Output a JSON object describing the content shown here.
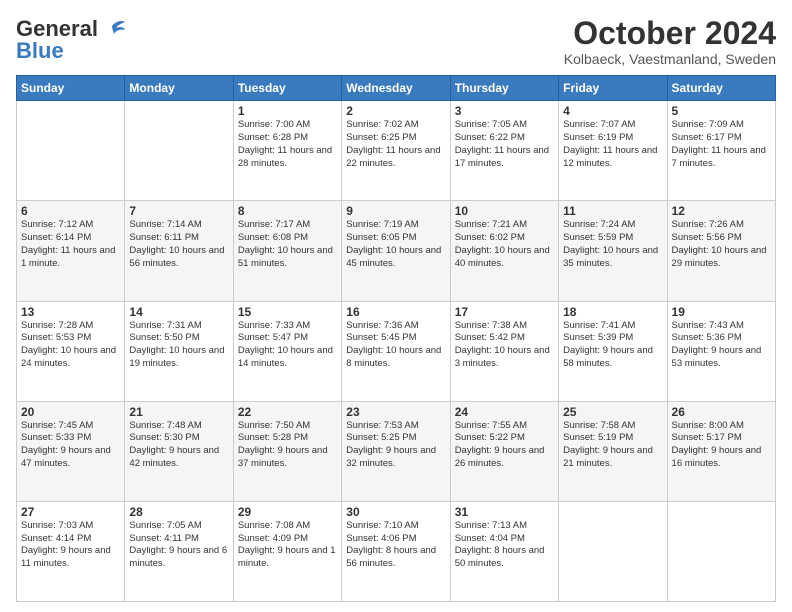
{
  "header": {
    "logo_line1": "General",
    "logo_line2": "Blue",
    "month": "October 2024",
    "location": "Kolbaeck, Vaestmanland, Sweden"
  },
  "weekdays": [
    "Sunday",
    "Monday",
    "Tuesday",
    "Wednesday",
    "Thursday",
    "Friday",
    "Saturday"
  ],
  "weeks": [
    [
      {
        "day": "",
        "info": ""
      },
      {
        "day": "",
        "info": ""
      },
      {
        "day": "1",
        "info": "Sunrise: 7:00 AM\nSunset: 6:28 PM\nDaylight: 11 hours and 28 minutes."
      },
      {
        "day": "2",
        "info": "Sunrise: 7:02 AM\nSunset: 6:25 PM\nDaylight: 11 hours and 22 minutes."
      },
      {
        "day": "3",
        "info": "Sunrise: 7:05 AM\nSunset: 6:22 PM\nDaylight: 11 hours and 17 minutes."
      },
      {
        "day": "4",
        "info": "Sunrise: 7:07 AM\nSunset: 6:19 PM\nDaylight: 11 hours and 12 minutes."
      },
      {
        "day": "5",
        "info": "Sunrise: 7:09 AM\nSunset: 6:17 PM\nDaylight: 11 hours and 7 minutes."
      }
    ],
    [
      {
        "day": "6",
        "info": "Sunrise: 7:12 AM\nSunset: 6:14 PM\nDaylight: 11 hours and 1 minute."
      },
      {
        "day": "7",
        "info": "Sunrise: 7:14 AM\nSunset: 6:11 PM\nDaylight: 10 hours and 56 minutes."
      },
      {
        "day": "8",
        "info": "Sunrise: 7:17 AM\nSunset: 6:08 PM\nDaylight: 10 hours and 51 minutes."
      },
      {
        "day": "9",
        "info": "Sunrise: 7:19 AM\nSunset: 6:05 PM\nDaylight: 10 hours and 45 minutes."
      },
      {
        "day": "10",
        "info": "Sunrise: 7:21 AM\nSunset: 6:02 PM\nDaylight: 10 hours and 40 minutes."
      },
      {
        "day": "11",
        "info": "Sunrise: 7:24 AM\nSunset: 5:59 PM\nDaylight: 10 hours and 35 minutes."
      },
      {
        "day": "12",
        "info": "Sunrise: 7:26 AM\nSunset: 5:56 PM\nDaylight: 10 hours and 29 minutes."
      }
    ],
    [
      {
        "day": "13",
        "info": "Sunrise: 7:28 AM\nSunset: 5:53 PM\nDaylight: 10 hours and 24 minutes."
      },
      {
        "day": "14",
        "info": "Sunrise: 7:31 AM\nSunset: 5:50 PM\nDaylight: 10 hours and 19 minutes."
      },
      {
        "day": "15",
        "info": "Sunrise: 7:33 AM\nSunset: 5:47 PM\nDaylight: 10 hours and 14 minutes."
      },
      {
        "day": "16",
        "info": "Sunrise: 7:36 AM\nSunset: 5:45 PM\nDaylight: 10 hours and 8 minutes."
      },
      {
        "day": "17",
        "info": "Sunrise: 7:38 AM\nSunset: 5:42 PM\nDaylight: 10 hours and 3 minutes."
      },
      {
        "day": "18",
        "info": "Sunrise: 7:41 AM\nSunset: 5:39 PM\nDaylight: 9 hours and 58 minutes."
      },
      {
        "day": "19",
        "info": "Sunrise: 7:43 AM\nSunset: 5:36 PM\nDaylight: 9 hours and 53 minutes."
      }
    ],
    [
      {
        "day": "20",
        "info": "Sunrise: 7:45 AM\nSunset: 5:33 PM\nDaylight: 9 hours and 47 minutes."
      },
      {
        "day": "21",
        "info": "Sunrise: 7:48 AM\nSunset: 5:30 PM\nDaylight: 9 hours and 42 minutes."
      },
      {
        "day": "22",
        "info": "Sunrise: 7:50 AM\nSunset: 5:28 PM\nDaylight: 9 hours and 37 minutes."
      },
      {
        "day": "23",
        "info": "Sunrise: 7:53 AM\nSunset: 5:25 PM\nDaylight: 9 hours and 32 minutes."
      },
      {
        "day": "24",
        "info": "Sunrise: 7:55 AM\nSunset: 5:22 PM\nDaylight: 9 hours and 26 minutes."
      },
      {
        "day": "25",
        "info": "Sunrise: 7:58 AM\nSunset: 5:19 PM\nDaylight: 9 hours and 21 minutes."
      },
      {
        "day": "26",
        "info": "Sunrise: 8:00 AM\nSunset: 5:17 PM\nDaylight: 9 hours and 16 minutes."
      }
    ],
    [
      {
        "day": "27",
        "info": "Sunrise: 7:03 AM\nSunset: 4:14 PM\nDaylight: 9 hours and 11 minutes."
      },
      {
        "day": "28",
        "info": "Sunrise: 7:05 AM\nSunset: 4:11 PM\nDaylight: 9 hours and 6 minutes."
      },
      {
        "day": "29",
        "info": "Sunrise: 7:08 AM\nSunset: 4:09 PM\nDaylight: 9 hours and 1 minute."
      },
      {
        "day": "30",
        "info": "Sunrise: 7:10 AM\nSunset: 4:06 PM\nDaylight: 8 hours and 56 minutes."
      },
      {
        "day": "31",
        "info": "Sunrise: 7:13 AM\nSunset: 4:04 PM\nDaylight: 8 hours and 50 minutes."
      },
      {
        "day": "",
        "info": ""
      },
      {
        "day": "",
        "info": ""
      }
    ]
  ]
}
